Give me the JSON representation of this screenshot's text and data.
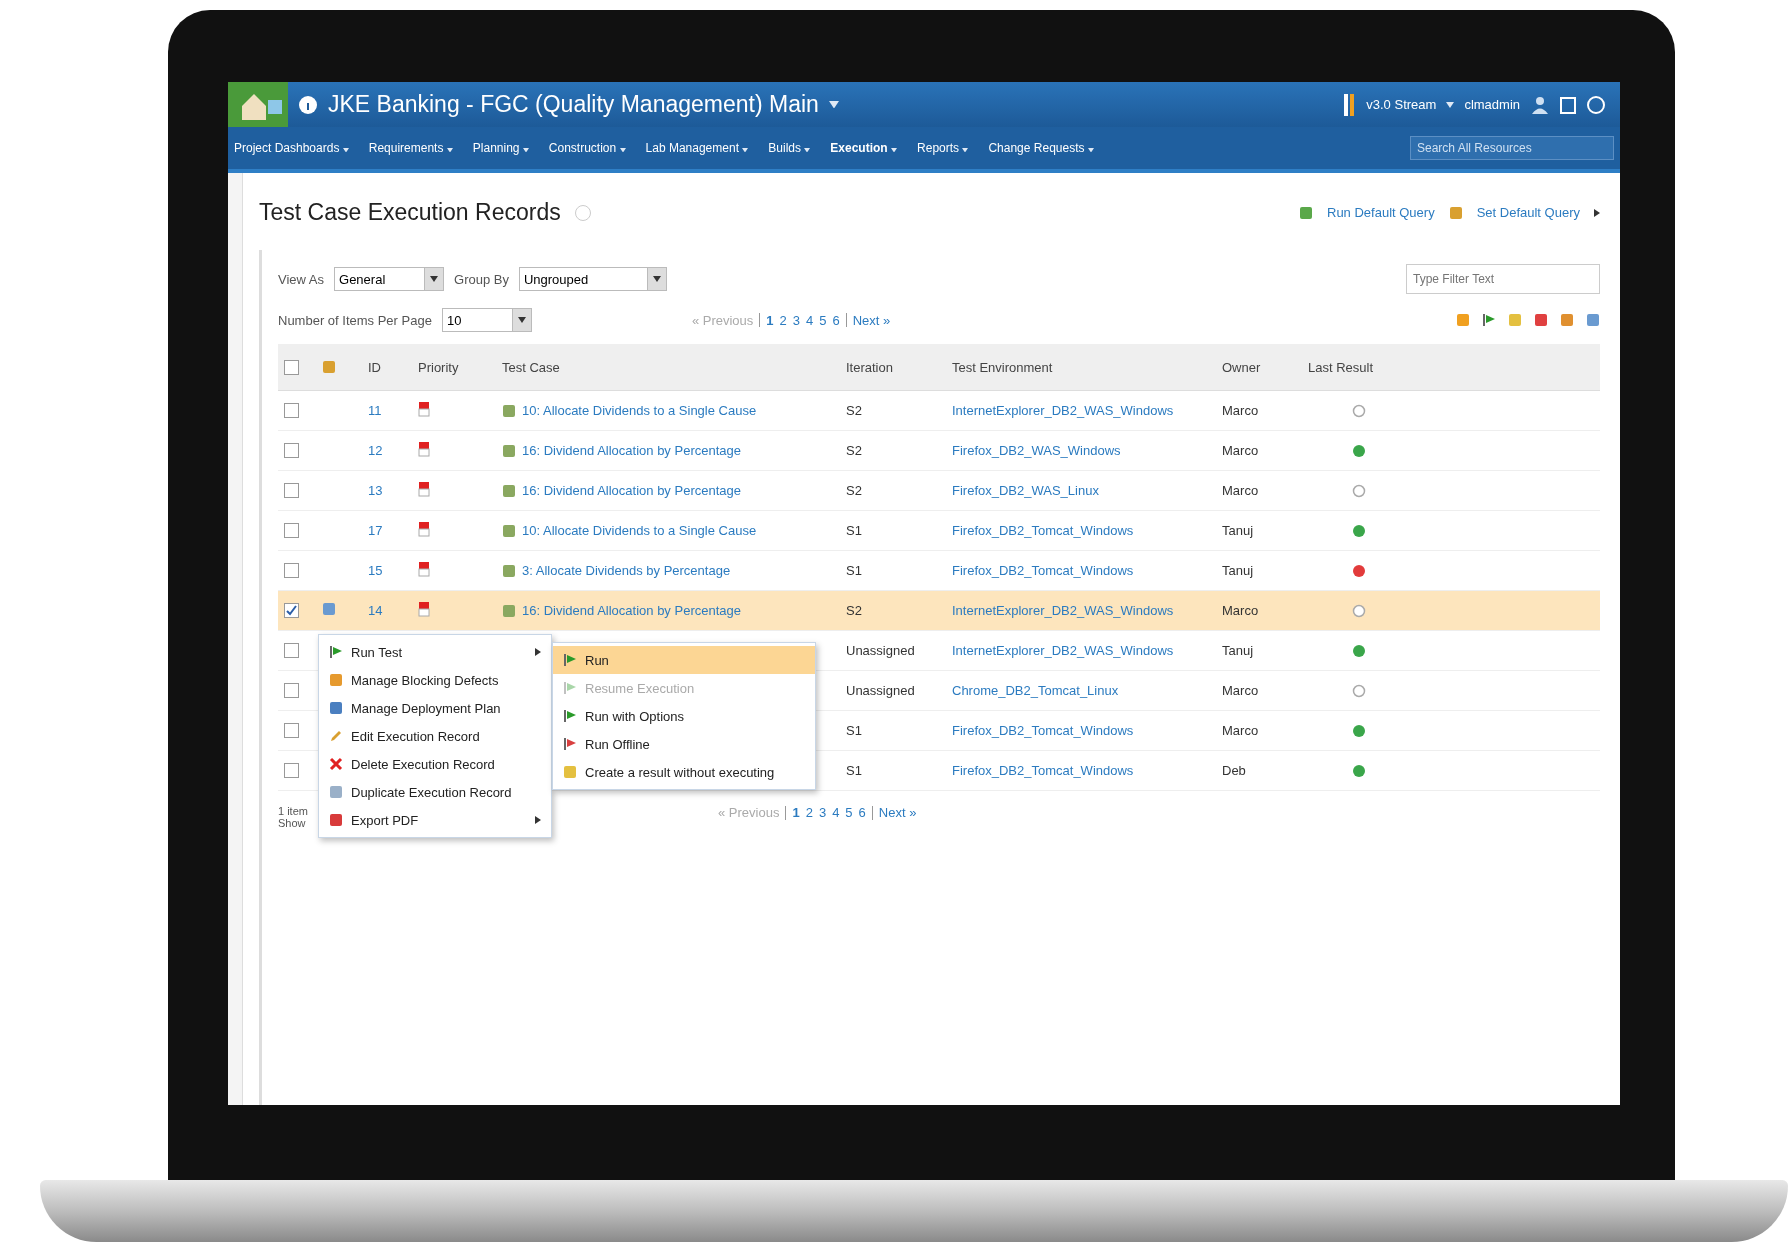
{
  "header": {
    "title": "JKE Banking - FGC (Quality Management)  Main",
    "stream": "v3.0 Stream",
    "user": "clmadmin"
  },
  "nav": [
    {
      "label": "Project Dashboards",
      "selected": false
    },
    {
      "label": "Requirements",
      "selected": false
    },
    {
      "label": "Planning",
      "selected": false
    },
    {
      "label": "Construction",
      "selected": false
    },
    {
      "label": "Lab Management",
      "selected": false
    },
    {
      "label": "Builds",
      "selected": false
    },
    {
      "label": "Execution",
      "selected": true
    },
    {
      "label": "Reports",
      "selected": false
    },
    {
      "label": "Change Requests",
      "selected": false
    }
  ],
  "search": {
    "placeholder": "Search All Resources"
  },
  "page": {
    "title": "Test Case Execution Records",
    "links": [
      "Run Default Query",
      "Set Default Query"
    ]
  },
  "filters": {
    "view_as_label": "View As",
    "view_as": "General",
    "group_by_label": "Group By",
    "group_by": "Ungrouped",
    "filter_placeholder": "Type Filter Text",
    "per_page_label": "Number of Items Per Page",
    "per_page": "10"
  },
  "pagination": {
    "previous": "« Previous",
    "pages": [
      {
        "label": "1",
        "selected": true
      },
      {
        "label": "2",
        "selected": false
      },
      {
        "label": "3",
        "selected": false
      },
      {
        "label": "4",
        "selected": false
      },
      {
        "label": "5",
        "selected": false
      },
      {
        "label": "6",
        "selected": false
      }
    ],
    "next": "Next »"
  },
  "pagination_bottom": {
    "previous": "« Previous",
    "pages": [
      {
        "label": "1",
        "selected": true
      },
      {
        "label": "2",
        "selected": false
      },
      {
        "label": "3",
        "selected": false
      },
      {
        "label": "4",
        "selected": false
      },
      {
        "label": "5",
        "selected": false
      },
      {
        "label": "6",
        "selected": false
      }
    ],
    "next": "Next »"
  },
  "table": {
    "select_all_checked": false,
    "columns": [
      "ID",
      "Priority",
      "Test Case",
      "Iteration",
      "Test Environment",
      "Owner",
      "Last Result"
    ],
    "rows": [
      {
        "id": "11",
        "test_case": "10: Allocate Dividends to a Single Cause",
        "iteration": "S2",
        "environment": "InternetExplorer_DB2_WAS_Windows",
        "owner": "Marco",
        "color": "#aaaaaa",
        "checked": false,
        "selected": false
      },
      {
        "id": "12",
        "test_case": "16: Dividend Allocation by Percentage",
        "iteration": "S2",
        "environment": "Firefox_DB2_WAS_Windows",
        "owner": "Marco",
        "color": "#3aa64a",
        "checked": false,
        "selected": false
      },
      {
        "id": "13",
        "test_case": "16: Dividend Allocation by Percentage",
        "iteration": "S2",
        "environment": "Firefox_DB2_WAS_Linux",
        "owner": "Marco",
        "color": "#aaaaaa",
        "checked": false,
        "selected": false
      },
      {
        "id": "17",
        "test_case": "10: Allocate Dividends to a Single Cause",
        "iteration": "S1",
        "environment": "Firefox_DB2_Tomcat_Windows",
        "owner": "Tanuj",
        "color": "#3aa64a",
        "checked": false,
        "selected": false
      },
      {
        "id": "15",
        "test_case": "3: Allocate Dividends by Percentage",
        "iteration": "S1",
        "environment": "Firefox_DB2_Tomcat_Windows",
        "owner": "Tanuj",
        "color": "#e23b3b",
        "checked": false,
        "selected": false
      },
      {
        "id": "14",
        "test_case": "16: Dividend Allocation by Percentage",
        "iteration": "S2",
        "environment": "InternetExplorer_DB2_WAS_Windows",
        "owner": "Marco",
        "color": "#aaaaaa",
        "checked": true,
        "selected": true
      },
      {
        "iteration": "Unassigned",
        "environment": "InternetExplorer_DB2_WAS_Windows",
        "owner": "Tanuj",
        "color": "#3aa64a",
        "checked": false,
        "selected": false
      },
      {
        "iteration": "Unassigned",
        "environment": "Chrome_DB2_Tomcat_Linux",
        "owner": "Marco",
        "color": "#aaaaaa",
        "checked": false,
        "selected": false
      },
      {
        "iteration": "S1",
        "environment": "Firefox_DB2_Tomcat_Windows",
        "owner": "Marco",
        "color": "#3aa64a",
        "checked": false,
        "selected": false
      },
      {
        "iteration": "S1",
        "environment": "Firefox_DB2_Tomcat_Windows",
        "owner": "Deb",
        "color": "#3aa64a",
        "checked": false,
        "selected": false
      }
    ]
  },
  "footer": {
    "count": "1 item",
    "showing": "Show"
  },
  "context_menu": [
    {
      "label": "Run Test",
      "kind": "run",
      "submenu": true
    },
    {
      "label": "Manage Blocking Defects",
      "kind": "defects",
      "submenu": false
    },
    {
      "label": "Manage Deployment Plan",
      "kind": "deploy",
      "submenu": false
    },
    {
      "label": "Edit Execution Record",
      "kind": "edit",
      "submenu": false
    },
    {
      "label": "Delete Execution Record",
      "kind": "delete",
      "submenu": false
    },
    {
      "label": "Duplicate Execution Record",
      "kind": "duplicate",
      "submenu": false
    },
    {
      "label": "Export PDF",
      "kind": "pdf",
      "submenu": true
    }
  ],
  "submenu": [
    {
      "label": "Run",
      "kind": "run",
      "selected": true,
      "disabled": false
    },
    {
      "label": "Resume Execution",
      "kind": "run",
      "selected": false,
      "disabled": true
    },
    {
      "label": "Run with Options",
      "kind": "run",
      "selected": false,
      "disabled": false
    },
    {
      "label": "Run Offline",
      "kind": "offline",
      "selected": false,
      "disabled": false
    },
    {
      "label": "Create a result without executing",
      "kind": "result",
      "selected": false,
      "disabled": false
    }
  ]
}
